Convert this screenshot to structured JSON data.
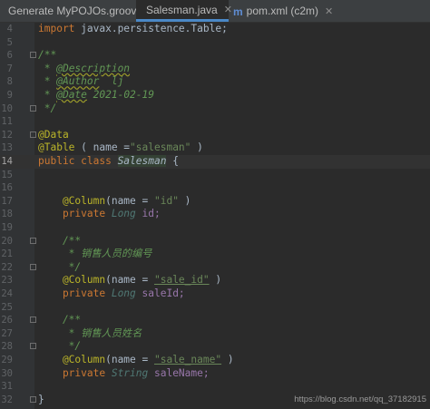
{
  "tabs": [
    {
      "label": "Generate MyPOJOs.groovy",
      "active": false
    },
    {
      "label": "Salesman.java",
      "active": true
    },
    {
      "label": "pom.xml (c2m)",
      "active": false
    }
  ],
  "lines": {
    "l4": {
      "num": "4",
      "a": "import",
      "b": " javax.persistence.Table;"
    },
    "l5": {
      "num": "5"
    },
    "l6": {
      "num": "6",
      "t": "/**"
    },
    "l7": {
      "num": "7",
      "a": " * ",
      "b": "@Description"
    },
    "l8": {
      "num": "8",
      "a": " * ",
      "b": "@Author",
      "c": "  lj"
    },
    "l9": {
      "num": "9",
      "a": " * ",
      "b": "@Date",
      "c": " 2021-02-19"
    },
    "l10": {
      "num": "10",
      "t": " */"
    },
    "l11": {
      "num": "11"
    },
    "l12": {
      "num": "12",
      "t": "@Data"
    },
    "l13": {
      "num": "13",
      "a": "@Table",
      "b": " ( name =",
      "c": "\"salesman\"",
      "d": " )"
    },
    "l14": {
      "num": "14",
      "a": "public class ",
      "b": "Salesman",
      "c": " {"
    },
    "l15": {
      "num": "15"
    },
    "l16": {
      "num": "16"
    },
    "l17": {
      "num": "17",
      "a": "    @Column",
      "b": "(name = ",
      "c": "\"id\"",
      "d": " )"
    },
    "l18": {
      "num": "18",
      "a": "    private ",
      "b": "Long",
      "c": " id;"
    },
    "l19": {
      "num": "19"
    },
    "l20": {
      "num": "20",
      "t": "    /**"
    },
    "l21": {
      "num": "21",
      "t": "     * 销售人员的编号"
    },
    "l22": {
      "num": "22",
      "t": "     */"
    },
    "l23": {
      "num": "23",
      "a": "    @Column",
      "b": "(name = ",
      "c": "\"sale_id\"",
      "d": " )"
    },
    "l24": {
      "num": "24",
      "a": "    private ",
      "b": "Long",
      "c": " saleId;"
    },
    "l25": {
      "num": "25"
    },
    "l26": {
      "num": "26",
      "t": "    /**"
    },
    "l27": {
      "num": "27",
      "t": "     * 销售人员姓名"
    },
    "l28": {
      "num": "28",
      "t": "     */"
    },
    "l29": {
      "num": "29",
      "a": "    @Column",
      "b": "(name = ",
      "c": "\"sale_name\"",
      "d": " )"
    },
    "l30": {
      "num": "30",
      "a": "    private ",
      "b": "String",
      "c": " saleName;"
    },
    "l31": {
      "num": "31"
    },
    "l32": {
      "num": "32",
      "t": "}"
    }
  },
  "watermark": "https://blog.csdn.net/qq_37182915"
}
